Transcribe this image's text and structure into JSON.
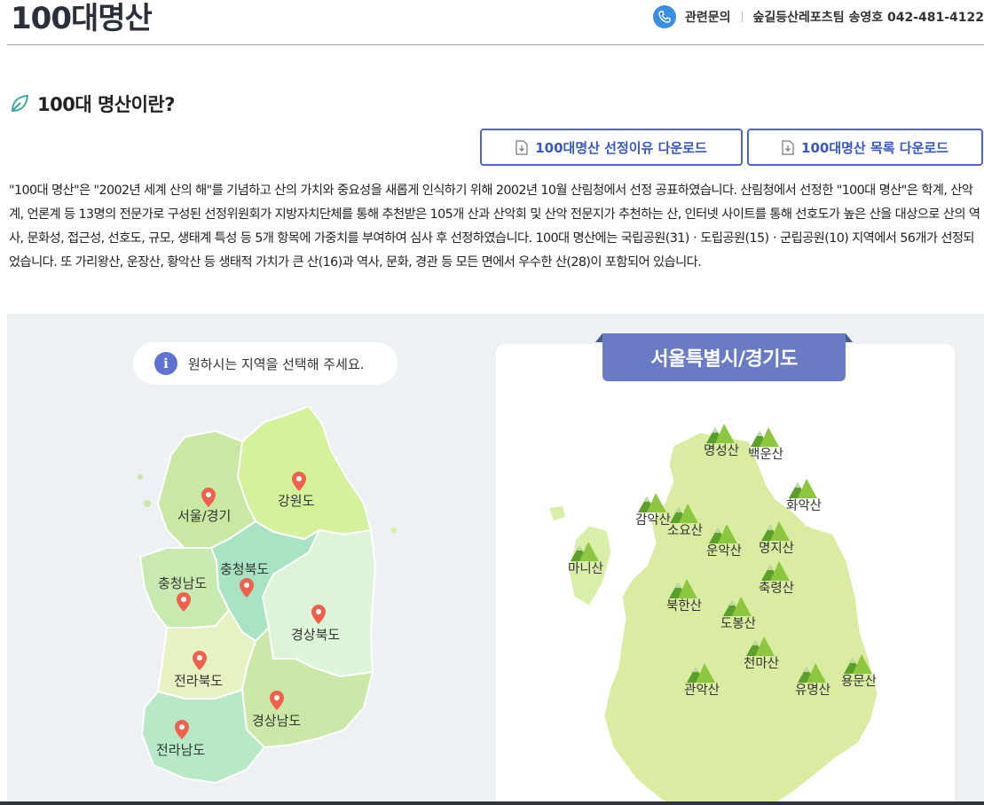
{
  "header": {
    "title": "100대명산",
    "contact_label": "관련문의",
    "contact_team": "숲길등산레포츠팀 송영호 042-481-4122",
    "phone_icon": "phone-icon"
  },
  "section": {
    "title": "100대 명산이란?",
    "icon": "leaf-icon"
  },
  "buttons": {
    "reason_download": "100대명산 선정이유 다운로드",
    "list_download": "100대명산 목록 다운로드"
  },
  "intro": {
    "text": "\"100대 명산\"은 \"2002년 세계 산의 해\"를 기념하고 산의 가치와 중요성을 새롭게 인식하기 위해 2002년 10월 산림청에서 선정 공표하였습니다. 산림청에서 선정한 \"100대 명산\"은 학계, 산악계, 언론계 등 13명의 전문가로 구성된 선정위원회가 지방자치단체를 통해 추천받은 105개 산과 산악회 및 산악 전문지가 추천하는 산, 인터넷 사이트를 통해 선호도가 높은 산을 대상으로 산의 역사, 문화성, 접근성, 선호도, 규모, 생태계 특성 등 5개 항목에 가중치를 부여하여 심사 후 선정하였습니다. 100대 명산에는 국립공원(31)ㆍ도립공원(15)ㆍ군립공원(10) 지역에서 56개가 선정되었습니다. 또 가리왕산, 운장산, 황악산 등 생태적 가치가 큰 산(16)과 역사, 문화, 경관 등 모든 면에서 우수한 산(28)이 포함되어 있습니다."
  },
  "map": {
    "hint": "원하시는 지역을 선택해 주세요.",
    "regions": [
      {
        "name": "서울/경기",
        "color": "#c9e8a4"
      },
      {
        "name": "강원도",
        "color": "#d4f19b"
      },
      {
        "name": "충청북도",
        "color": "#a8e3c4"
      },
      {
        "name": "충청남도",
        "color": "#c8eab0"
      },
      {
        "name": "경상북도",
        "color": "#dcf4d8"
      },
      {
        "name": "전라북도",
        "color": "#e6f2c2"
      },
      {
        "name": "경상남도",
        "color": "#cbe8a9"
      },
      {
        "name": "전라남도",
        "color": "#b8e9c6"
      }
    ],
    "selected_region": "서울특별시/경기도",
    "mountains": [
      "명성산",
      "백운산",
      "화악산",
      "감악산",
      "소요산",
      "운악산",
      "명지산",
      "마니산",
      "축령산",
      "북한산",
      "도봉산",
      "천마산",
      "관악산",
      "유명산",
      "용문산"
    ]
  },
  "colors": {
    "accent_blue": "#3757c1",
    "title_panel": "#6a7bc6",
    "pin_red": "#f0604d",
    "mountain_green": "#6cab2e"
  }
}
